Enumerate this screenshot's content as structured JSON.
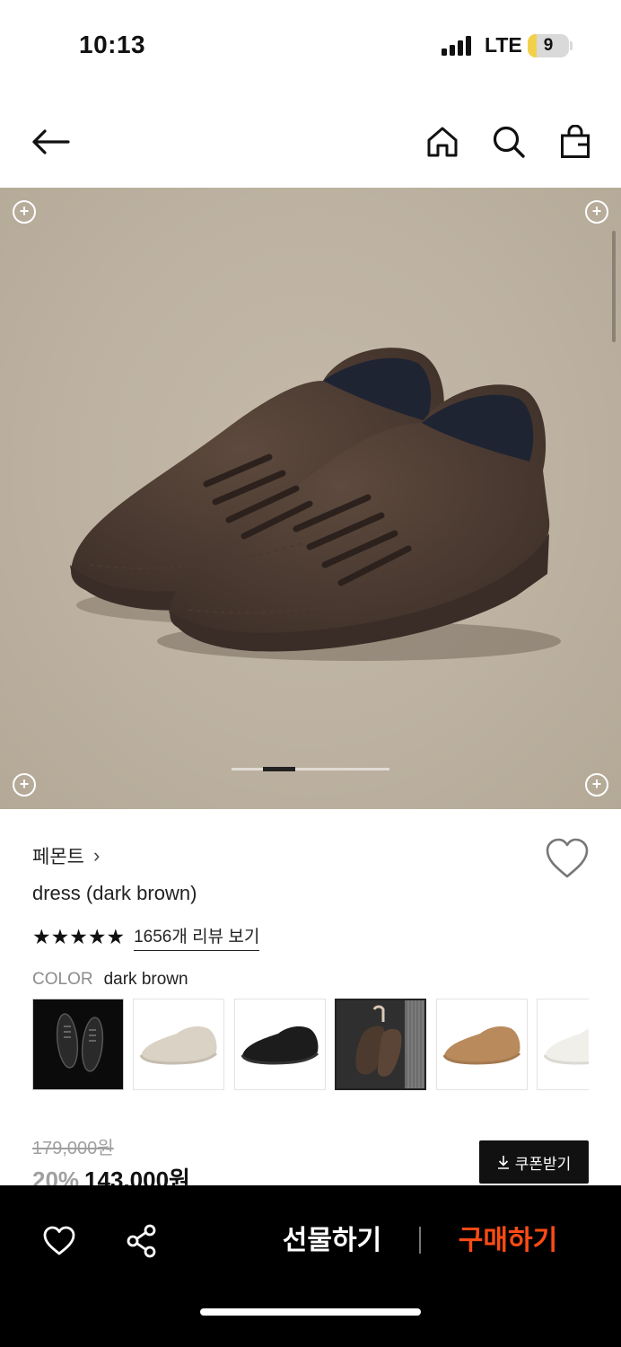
{
  "status_bar": {
    "time": "10:13",
    "network": "LTE",
    "battery": "9"
  },
  "header": {
    "icons": [
      "back-arrow-icon",
      "home-icon",
      "search-icon",
      "shopping-bag-icon"
    ]
  },
  "hero": {
    "image": "dark brown suede sneakers",
    "pager": {
      "current": 2,
      "total": 5
    }
  },
  "product": {
    "brand": "페몬트",
    "brand_chevron": "›",
    "name": "dress (dark brown)",
    "stars": "★★★★★",
    "rating": 5,
    "review_link": "1656개 리뷰 보기",
    "color_label": "COLOR",
    "color_value": "dark brown",
    "variants": [
      "black (model)",
      "beige",
      "black",
      "dark brown",
      "tan",
      "white"
    ],
    "selected_variant": 3
  },
  "price": {
    "original": "179,000원",
    "discount": "20%",
    "sale": "143,000원",
    "coupon_label": "쿠폰받기"
  },
  "bottom_bar": {
    "gift_label": "선물하기",
    "buy_label": "구매하기",
    "buy_color": "#ff4b14"
  }
}
